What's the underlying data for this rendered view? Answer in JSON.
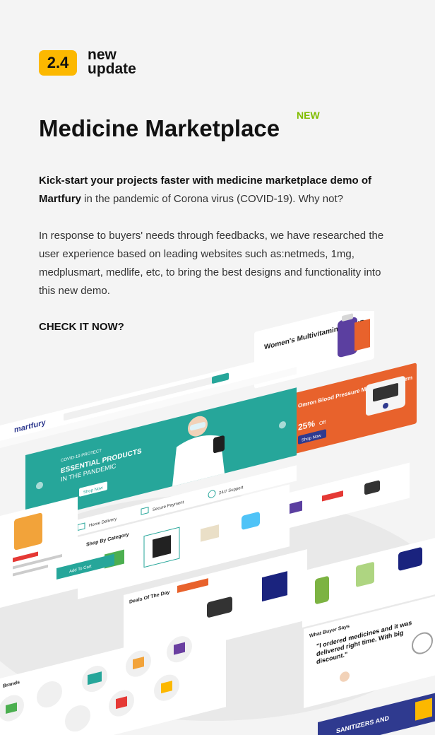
{
  "badge": {
    "version": "2.4",
    "line1": "new",
    "line2": "update"
  },
  "title": "Medicine Marketplace",
  "new_tag": "NEW",
  "intro": {
    "bold": "Kick-start your projects faster with medicine marketplace demo of Martfury",
    "rest": " in the pandemic of Corona virus (COVID-19). Why not?"
  },
  "paragraph": "In response to buyers' needs through feedbacks, we have researched the user experience based on leading websites such as:netmeds, 1mg, medplusmart, medlife, etc, to bring the best designs and functionality into this new demo.",
  "cta": "CHECK IT NOW?",
  "mockup": {
    "logo": "martfury",
    "hero_tag": "COVID-19 PROTECT",
    "hero_title_1": "ESSENTIAL PRODUCTS",
    "hero_title_2": "IN THE PANDEMIC",
    "hero_button": "Shop Now",
    "feature_1": "Home Delivery",
    "feature_2": "Secure Payment",
    "feature_3": "24/7 Support",
    "banner_1_title": "Women's Multivitamin by EXP",
    "banner_2_title": "Omron Blood Pressure Monitor Upper Arm",
    "banner_2_discount": "25%",
    "banner_2_discount_suffix": "Off",
    "banner_2_button": "Shop Now",
    "section_category": "Shop By Category",
    "section_deal": "Deals Of The Day",
    "section_buyers": "What Buyer Says",
    "section_brands": "Brands",
    "quote": "\"I ordered medicines and it was delivered right time. With big discount.\"",
    "sanitizer_banner": "SANITIZERS AND",
    "add_to_cart": "Add To Cart",
    "colors": {
      "teal": "#26a69a",
      "orange": "#e8622c",
      "navy": "#2f3a8f",
      "accent": "#fcb800",
      "new_green": "#80bc00"
    }
  }
}
